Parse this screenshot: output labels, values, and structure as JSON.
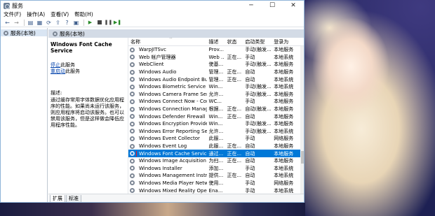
{
  "window": {
    "title": "服务",
    "minimize": "─",
    "maximize": "☐",
    "close": "✕"
  },
  "menu": [
    "文件(F)",
    "操作(A)",
    "查看(V)",
    "帮助(H)"
  ],
  "tree": {
    "root": "服务(本地)"
  },
  "panel": {
    "header": "服务(本地)",
    "selected_service": "Windows Font Cache Service",
    "stop_link": "停止",
    "stop_suffix": "此服务",
    "restart_link": "重启动",
    "restart_suffix": "此服务",
    "desc_label": "描述:",
    "description": "通过缓存常用字体数据优化应用程序的性能。如果尚未运行该服务，则应用程序将启动该服务。也可以禁用该服务，但是这样做会降低应用程序性能。"
  },
  "columns": {
    "name": "名称",
    "desc": "描述",
    "status": "状态",
    "startup": "启动类型",
    "logon": "登录为"
  },
  "rows": [
    {
      "name": "WarpJITSvc",
      "desc": "Prov...",
      "status": "",
      "startup": "手动(触发...",
      "logon": "本地服务"
    },
    {
      "name": "Web 帐户管理器",
      "desc": "Web ...",
      "status": "正在...",
      "startup": "手动",
      "logon": "本地系统"
    },
    {
      "name": "WebClient",
      "desc": "使基...",
      "status": "",
      "startup": "手动(触发...",
      "logon": "本地服务"
    },
    {
      "name": "Windows Audio",
      "desc": "管理...",
      "status": "正在...",
      "startup": "自动",
      "logon": "本地服务"
    },
    {
      "name": "Windows Audio Endpoint Buil...",
      "desc": "管理...",
      "status": "正在...",
      "startup": "自动",
      "logon": "本地系统"
    },
    {
      "name": "Windows Biometric Service",
      "desc": "Win...",
      "status": "",
      "startup": "手动(触发...",
      "logon": "本地系统"
    },
    {
      "name": "Windows Camera Frame Serv...",
      "desc": "允许...",
      "status": "",
      "startup": "手动(触发...",
      "logon": "本地服务"
    },
    {
      "name": "Windows Connect Now - Con...",
      "desc": "WC...",
      "status": "",
      "startup": "手动",
      "logon": "本地服务"
    },
    {
      "name": "Windows Connection Manager",
      "desc": "根据...",
      "status": "正在...",
      "startup": "自动(触发...",
      "logon": "本地服务"
    },
    {
      "name": "Windows Defender Firewall",
      "desc": "Win...",
      "status": "正在...",
      "startup": "自动",
      "logon": "本地服务"
    },
    {
      "name": "Windows Encryption Provider...",
      "desc": "Win...",
      "status": "",
      "startup": "手动(触发...",
      "logon": "本地服务"
    },
    {
      "name": "Windows Error Reporting Se...",
      "desc": "允许...",
      "status": "",
      "startup": "手动(触发...",
      "logon": "本地系统"
    },
    {
      "name": "Windows Event Collector",
      "desc": "此服...",
      "status": "",
      "startup": "手动",
      "logon": "网络服务"
    },
    {
      "name": "Windows Event Log",
      "desc": "此服...",
      "status": "正在...",
      "startup": "自动",
      "logon": "本地服务"
    },
    {
      "name": "Windows Font Cache Service",
      "desc": "通过...",
      "status": "正在...",
      "startup": "自动",
      "logon": "本地服务",
      "selected": true
    },
    {
      "name": "Windows Image Acquisition ...",
      "desc": "为扫...",
      "status": "正在...",
      "startup": "自动",
      "logon": "本地服务"
    },
    {
      "name": "Windows Installer",
      "desc": "添加...",
      "status": "",
      "startup": "手动",
      "logon": "本地系统"
    },
    {
      "name": "Windows Management Instru...",
      "desc": "提供...",
      "status": "正在...",
      "startup": "自动",
      "logon": "本地系统"
    },
    {
      "name": "Windows Media Player Netw...",
      "desc": "使用...",
      "status": "",
      "startup": "手动",
      "logon": "网络服务"
    },
    {
      "name": "Windows Mixed Reality Open...",
      "desc": "Ena...",
      "status": "",
      "startup": "手动",
      "logon": "本地系统"
    }
  ],
  "tabs": [
    "扩展",
    "标准"
  ]
}
